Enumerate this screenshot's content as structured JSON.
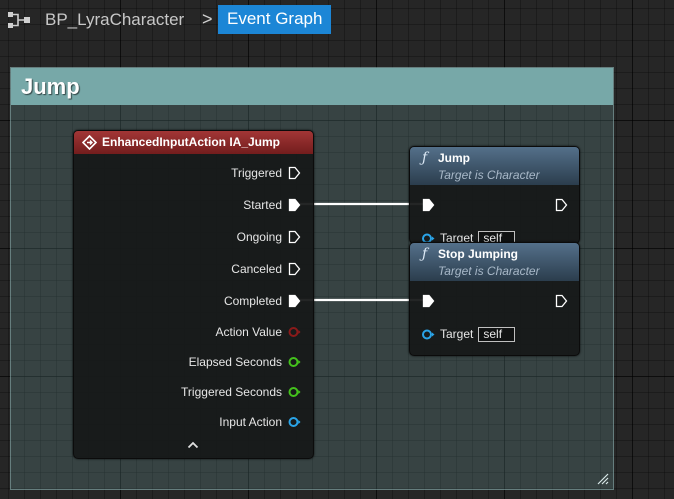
{
  "breadcrumb": {
    "blueprint_name": "BP_LyraCharacter",
    "separator": ">",
    "active_tab": "Event Graph"
  },
  "comment_box": {
    "title": "Jump",
    "color": "#77a8a8"
  },
  "event_node": {
    "title": "EnhancedInputAction IA_Jump",
    "header_color": "#a23636",
    "outputs": [
      {
        "label": "Triggered",
        "type": "exec",
        "color": "#ffffff"
      },
      {
        "label": "Started",
        "type": "exec",
        "color": "#ffffff",
        "connected": true
      },
      {
        "label": "Ongoing",
        "type": "exec",
        "color": "#ffffff"
      },
      {
        "label": "Canceled",
        "type": "exec",
        "color": "#ffffff"
      },
      {
        "label": "Completed",
        "type": "exec",
        "color": "#ffffff",
        "connected": true
      },
      {
        "label": "Action Value",
        "type": "data",
        "color": "#8a1a1a"
      },
      {
        "label": "Elapsed Seconds",
        "type": "data",
        "color": "#44c21c"
      },
      {
        "label": "Triggered Seconds",
        "type": "data",
        "color": "#44c21c"
      },
      {
        "label": "Input Action",
        "type": "data",
        "color": "#2aa4e8"
      }
    ],
    "advanced_icon": "chevron-up-icon"
  },
  "function_nodes": [
    {
      "title": "Jump",
      "subtitle": "Target is Character",
      "icon": "function-icon",
      "icon_glyph": "ƒ",
      "target_label": "Target",
      "target_value": "self"
    },
    {
      "title": "Stop Jumping",
      "subtitle": "Target is Character",
      "icon": "function-icon",
      "icon_glyph": "ƒ",
      "target_label": "Target",
      "target_value": "self"
    }
  ],
  "colors": {
    "tab_active": "#1c86d6",
    "function_header": "#54708a",
    "object_pin": "#2aa4e8",
    "float_pin": "#44c21c",
    "struct_pin": "#8a1a1a",
    "exec_wire": "#ffffff"
  }
}
